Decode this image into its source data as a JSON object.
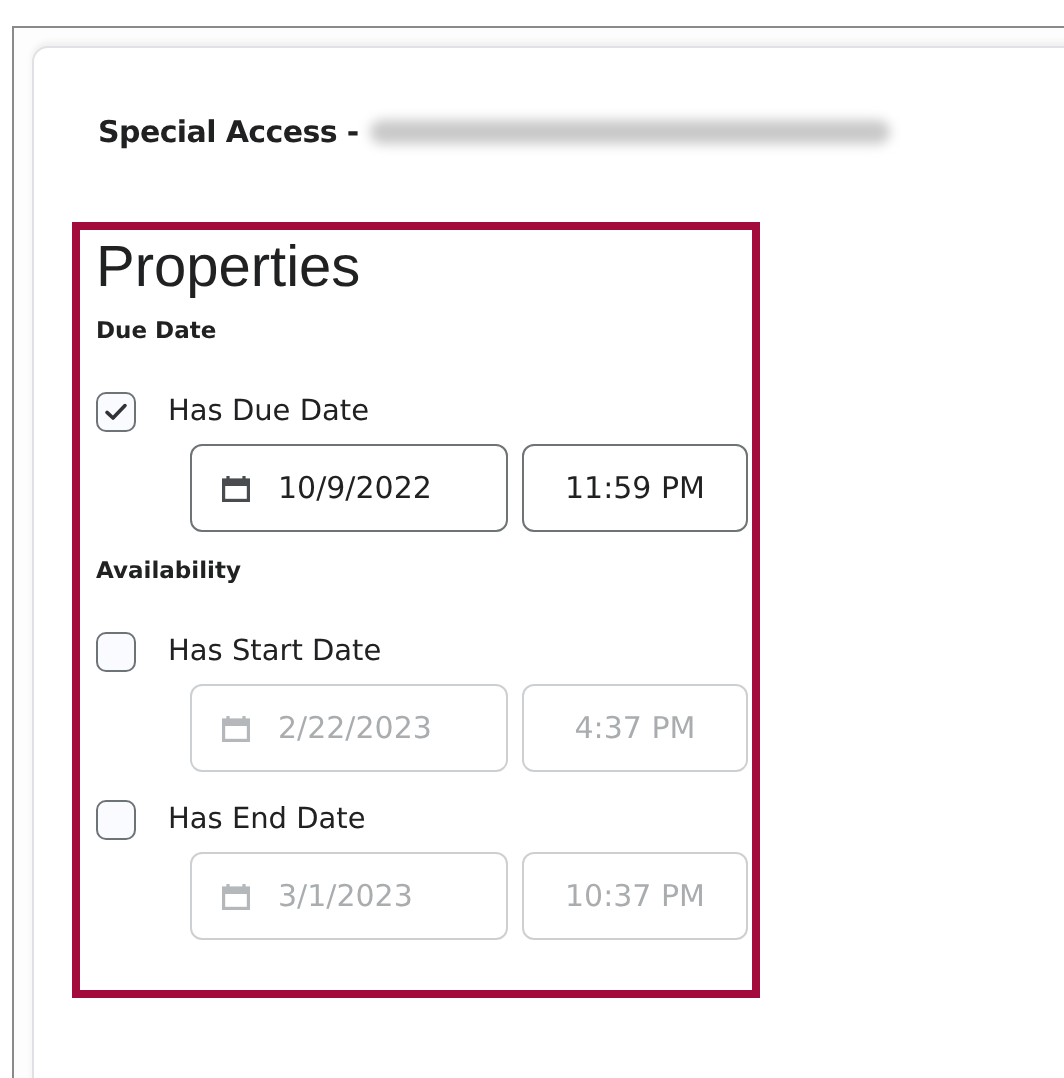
{
  "dialog": {
    "title": "Special Access -",
    "title_redacted": true
  },
  "properties": {
    "heading": "Properties",
    "sections": [
      {
        "heading": "Due Date",
        "options": [
          {
            "label": "Has Due Date",
            "checked": true,
            "date": "10/9/2022",
            "time": "11:59 PM",
            "disabled": false
          }
        ]
      },
      {
        "heading": "Availability",
        "options": [
          {
            "label": "Has Start Date",
            "checked": false,
            "date": "2/22/2023",
            "time": "4:37 PM",
            "disabled": true
          },
          {
            "label": "Has End Date",
            "checked": false,
            "date": "3/1/2023",
            "time": "10:37 PM",
            "disabled": true
          }
        ]
      }
    ]
  }
}
